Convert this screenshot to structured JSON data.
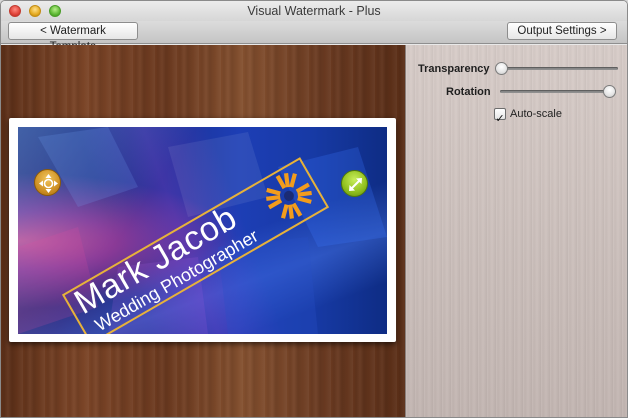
{
  "window": {
    "title": "Visual Watermark - Plus"
  },
  "toolbar": {
    "watermark_template_label": "< Watermark Template",
    "output_settings_label": "Output Settings >"
  },
  "settings": {
    "transparency_label": "Transparency",
    "transparency_value": 0.0,
    "rotation_label": "Rotation",
    "rotation_value": 0.93,
    "autoscale_label": "Auto-scale",
    "autoscale_checked": true
  },
  "watermark": {
    "name_text": "Mark Jacob",
    "tagline_text": "Wedding Photographer",
    "frame_color": "#e7b23a",
    "logo_color": "#f39c1c"
  },
  "colors": {
    "wood": "#6b391f",
    "panel": "#cdc1bd",
    "photo_blue": "#1d3eb5",
    "move_handle": "#cf9124",
    "scale_handle": "#8fbf1d"
  }
}
